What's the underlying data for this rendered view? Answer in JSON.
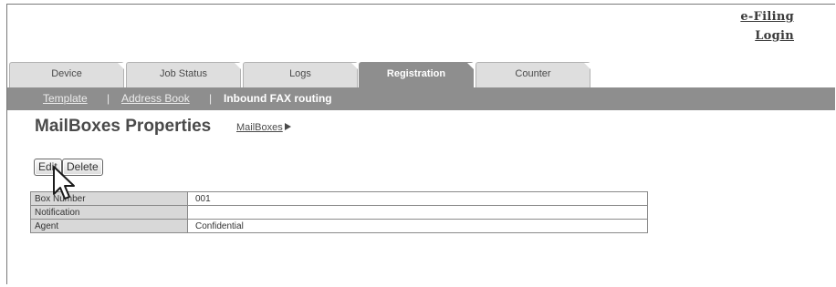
{
  "header": {
    "efiling_label": "e-Filing",
    "login_label": "Login"
  },
  "tabs": [
    {
      "label": "Device",
      "active": false
    },
    {
      "label": "Job Status",
      "active": false
    },
    {
      "label": "Logs",
      "active": false
    },
    {
      "label": "Registration",
      "active": true
    },
    {
      "label": "Counter",
      "active": false
    }
  ],
  "subnav": {
    "items": [
      {
        "label": "Template",
        "current": false
      },
      {
        "label": "Address Book",
        "current": false
      },
      {
        "label": "Inbound FAX routing",
        "current": true
      }
    ],
    "separator": "|"
  },
  "page": {
    "title": "MailBoxes Properties",
    "breadcrumb": "MailBoxes"
  },
  "actions": {
    "edit_label": "Edit",
    "delete_label": "Delete"
  },
  "properties": [
    {
      "label": "Box Number",
      "value": "001"
    },
    {
      "label": "Notification",
      "value": ""
    },
    {
      "label": "Agent",
      "value": "Confidential"
    }
  ],
  "colors": {
    "tab_bar": "#8e8e8e",
    "inactive_tab": "#dedede",
    "label_cell": "#d8d8d8"
  },
  "cursor": {
    "icon": "pointer-arrow-icon"
  }
}
